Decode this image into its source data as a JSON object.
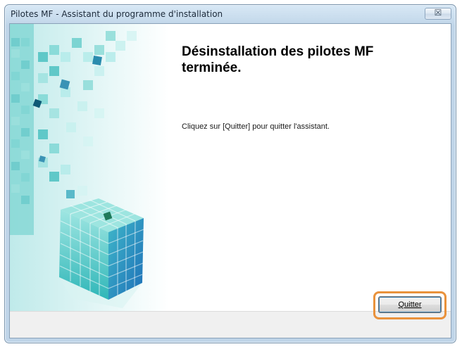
{
  "window": {
    "title": "Pilotes MF - Assistant du programme d'installation",
    "close_symbol": "☒"
  },
  "content": {
    "heading": "Désinstallation des pilotes MF terminée.",
    "instruction": "Cliquez sur [Quitter] pour quitter l'assistant."
  },
  "footer": {
    "quit_label": "Quitter"
  },
  "colors": {
    "highlight": "#e9923c",
    "art_teal": "#3fc4c4"
  },
  "icons": {
    "close": "close-icon",
    "art": "cube-graphic"
  }
}
